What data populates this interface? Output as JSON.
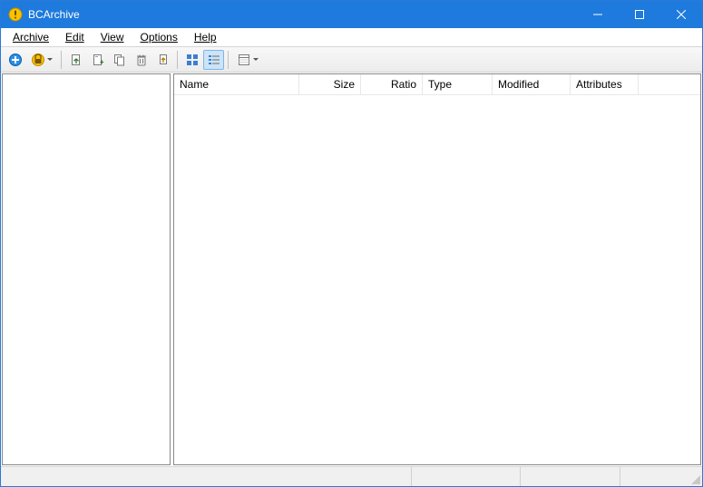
{
  "titlebar": {
    "title": "BCArchive"
  },
  "menu": {
    "archive": "Archive",
    "edit": "Edit",
    "view": "View",
    "options": "Options",
    "help": "Help"
  },
  "columns": {
    "name": "Name",
    "size": "Size",
    "ratio": "Ratio",
    "type": "Type",
    "modified": "Modified",
    "attributes": "Attributes"
  }
}
